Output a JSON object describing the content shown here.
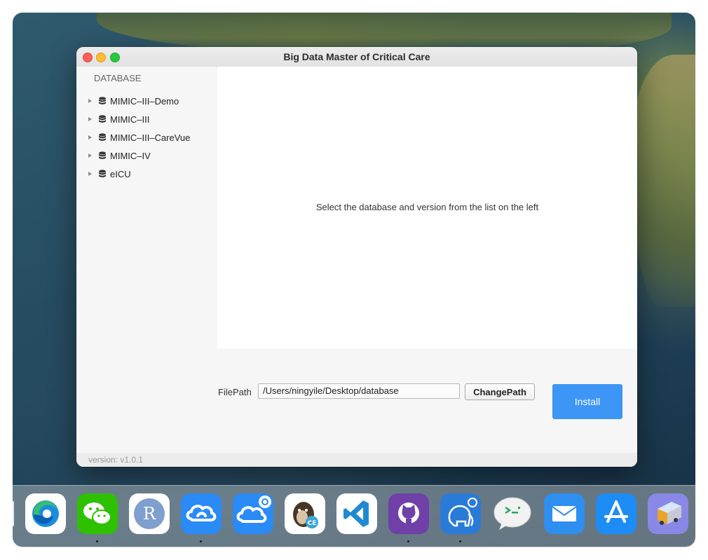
{
  "window": {
    "title": "Big Data Master of Critical Care"
  },
  "sidebar": {
    "heading": "DATABASE",
    "items": [
      {
        "label": "MIMIC–III–Demo",
        "icon": "database-icon"
      },
      {
        "label": "MIMIC–III",
        "icon": "database-icon"
      },
      {
        "label": "MIMIC–III–CareVue",
        "icon": "database-icon"
      },
      {
        "label": "MIMIC–IV",
        "icon": "database-icon"
      },
      {
        "label": "eICU",
        "icon": "database-icon"
      }
    ]
  },
  "content": {
    "placeholder": "Select the database and version from the list on the left"
  },
  "install_bar": {
    "filepath_label": "FilePath",
    "filepath_value": "/Users/ningyile/Desktop/database",
    "change_path_label": "ChangePath",
    "install_label": "Install"
  },
  "status": {
    "version": "version: v1.0.1"
  },
  "dock": {
    "apps": [
      {
        "icon": "microsoft-edge-icon",
        "running": false
      },
      {
        "icon": "wechat-icon",
        "running": true
      },
      {
        "icon": "r-language-icon",
        "running": false
      },
      {
        "icon": "baidu-netdisk-icon",
        "running": true
      },
      {
        "icon": "cloud-sync-icon",
        "running": false
      },
      {
        "icon": "dbeaver-ce-icon",
        "running": false
      },
      {
        "icon": "visual-studio-code-icon",
        "running": false
      },
      {
        "icon": "github-desktop-icon",
        "running": true
      },
      {
        "icon": "postgres-elephant-icon",
        "running": true
      },
      {
        "icon": "terminal-chat-icon",
        "running": false
      },
      {
        "icon": "mail-icon",
        "running": false
      },
      {
        "icon": "app-store-icon",
        "running": false
      },
      {
        "icon": "transmit-truck-icon",
        "running": false
      }
    ]
  },
  "colors": {
    "accent": "#3d96f5",
    "close": "#fe5f57",
    "minimize": "#febc2e",
    "maximize": "#28c840"
  }
}
